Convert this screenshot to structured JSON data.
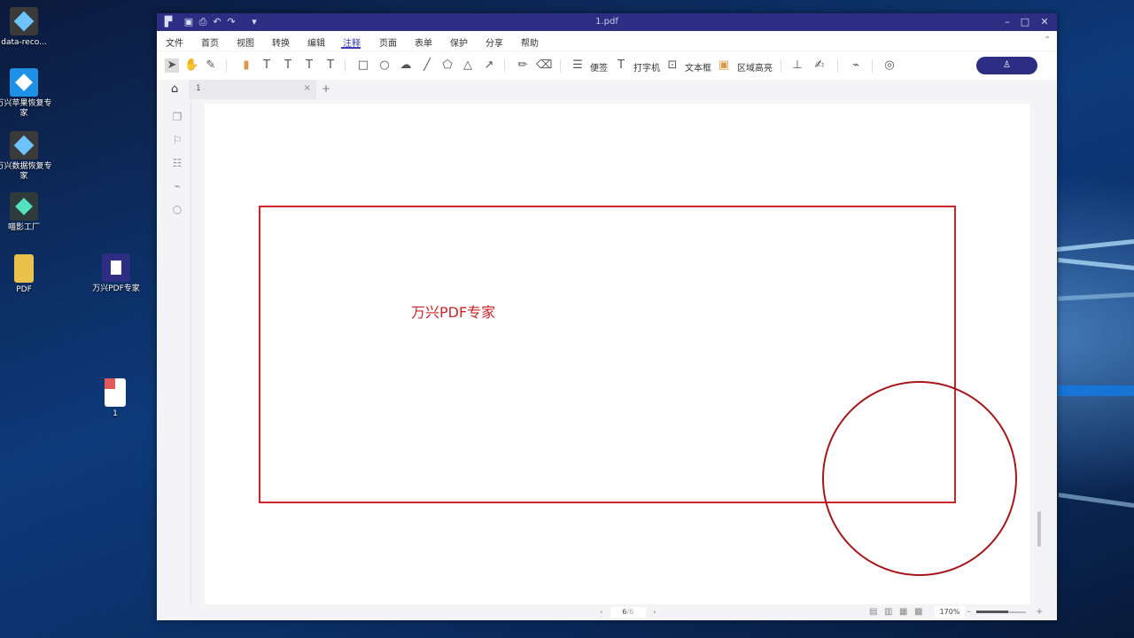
{
  "desktop": {
    "icons": [
      {
        "label": "data-reco...",
        "color": "#3a3a3a"
      },
      {
        "label": "万兴苹果恢复专家",
        "color": "#1e90e6"
      },
      {
        "label": "万兴数据恢复专家",
        "color": "#3a3a3a"
      },
      {
        "label": "喵影工厂",
        "color": "#2ea88f"
      },
      {
        "label": "PDF",
        "color": "#e8c24a"
      },
      {
        "label": "万兴PDF专家",
        "color": "#2d2e83"
      },
      {
        "label": "1",
        "color": "#ffffff"
      }
    ]
  },
  "window": {
    "title": "1.pdf",
    "menu": [
      "文件",
      "首页",
      "视图",
      "转换",
      "编辑",
      "注释",
      "页面",
      "表单",
      "保护",
      "分享",
      "帮助"
    ],
    "active_menu": "注释",
    "toolbar": {
      "sticky_note": "便签",
      "typewriter": "打字机",
      "text_box": "文本框",
      "area_highlight": "区域高亮"
    },
    "tab": {
      "name": "1",
      "close": "×",
      "add": "+"
    },
    "page_text": "万兴PDF专家",
    "status": {
      "page_current": "6",
      "page_total": "/6",
      "zoom": "170%"
    }
  },
  "colors": {
    "brand": "#2d2e83",
    "annotation": "#c8252a"
  }
}
